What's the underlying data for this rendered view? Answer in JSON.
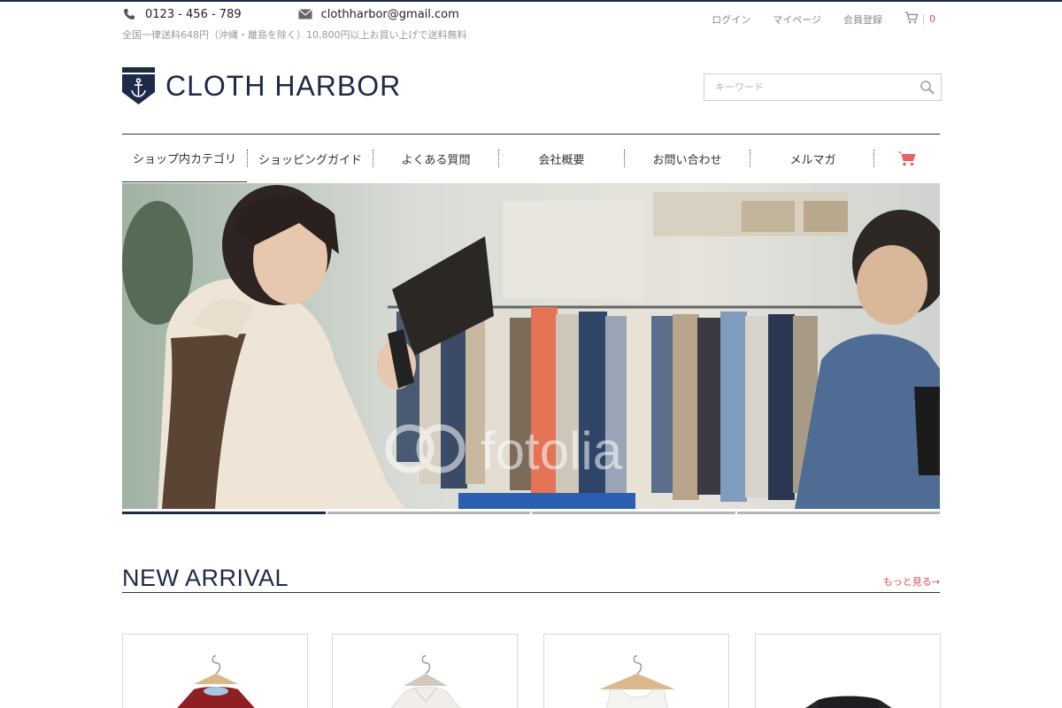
{
  "header": {
    "phone": "0123 - 456 - 789",
    "email": "clothharbor@gmail.com",
    "shipping_notice": "全国一律送料648円（沖縄・離島を除く）10,800円以上お買い上げで送料無料",
    "user_nav": {
      "login": "ログイン",
      "mypage": "マイページ",
      "register": "会員登録",
      "cart_count": "0"
    },
    "logo_text": "CLOTH HARBOR",
    "search_placeholder": "キーワード"
  },
  "nav": {
    "items": [
      {
        "label": "ショップ内カテゴリ"
      },
      {
        "label": "ショッピングガイド"
      },
      {
        "label": "よくある質問"
      },
      {
        "label": "会社概要"
      },
      {
        "label": "お問い合わせ"
      },
      {
        "label": "メルマガ"
      }
    ],
    "cart_icon": "cart-icon"
  },
  "hero": {
    "watermark": "fotolia",
    "slides_total": 4,
    "active_slide": 1
  },
  "new_arrival": {
    "title": "NEW ARRIVAL",
    "more_link": "もっと見る→",
    "products": [
      {
        "name": "red-sweater"
      },
      {
        "name": "white-blouse"
      },
      {
        "name": "white-top"
      },
      {
        "name": "black-top"
      }
    ]
  },
  "colors": {
    "brand_navy": "#1d2a48",
    "accent_red": "#e05050"
  }
}
